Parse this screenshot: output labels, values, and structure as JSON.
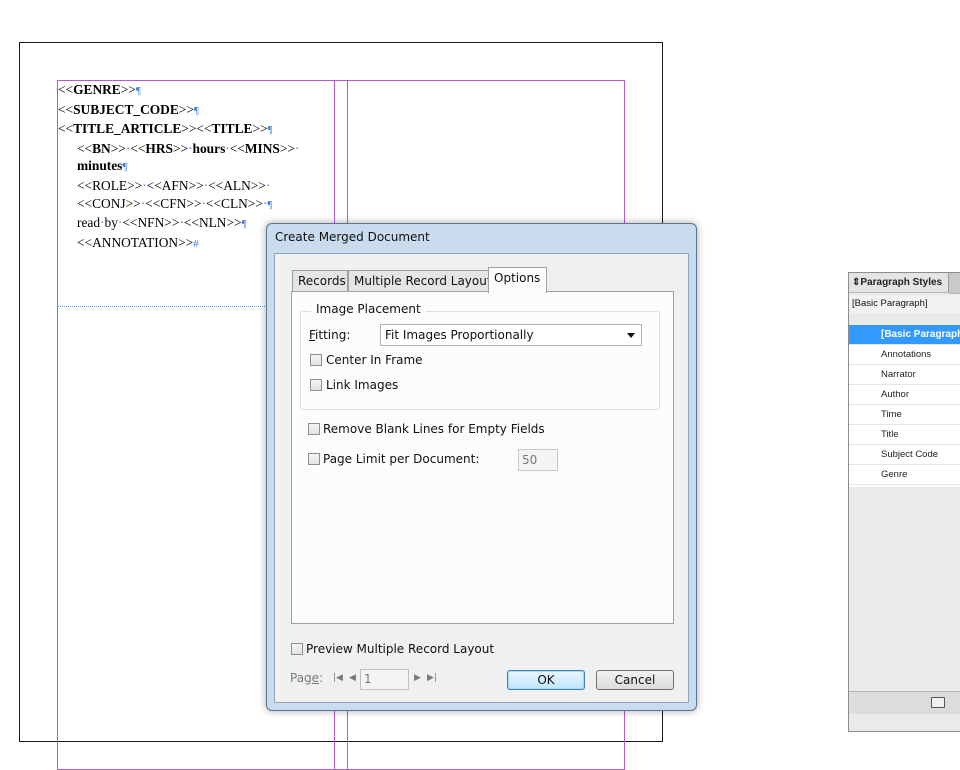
{
  "document": {
    "lines": [
      {
        "parts": [
          {
            "t": "<<",
            "b": false
          },
          {
            "t": "GENRE",
            "b": true
          },
          {
            "t": ">>",
            "b": false
          }
        ],
        "end": "¶",
        "indent": false
      },
      {
        "parts": [
          {
            "t": "<<",
            "b": false
          },
          {
            "t": "SUBJECT_CODE",
            "b": true
          },
          {
            "t": ">>",
            "b": false
          }
        ],
        "end": "¶",
        "indent": false
      },
      {
        "parts": [
          {
            "t": "<<",
            "b": false
          },
          {
            "t": "TITLE_ARTICLE",
            "b": true
          },
          {
            "t": ">><<",
            "b": false
          },
          {
            "t": "TITLE",
            "b": true
          },
          {
            "t": ">>",
            "b": false
          }
        ],
        "end": "¶",
        "indent": false
      },
      {
        "parts": [
          {
            "t": "<<",
            "b": false
          },
          {
            "t": "BN",
            "b": true
          },
          {
            "t": ">>",
            "b": false
          },
          {
            "t": "·",
            "dot": true
          },
          {
            "t": "<<",
            "b": false
          },
          {
            "t": "HRS",
            "b": true
          },
          {
            "t": ">>",
            "b": false
          },
          {
            "t": "·",
            "dot": true
          },
          {
            "t": "hours",
            "b": true
          },
          {
            "t": "·",
            "dot": true
          },
          {
            "t": "<<",
            "b": false
          },
          {
            "t": "MINS",
            "b": true
          },
          {
            "t": ">>",
            "b": false
          },
          {
            "t": "·",
            "dot": true
          }
        ],
        "end": "",
        "indent": true
      },
      {
        "parts": [
          {
            "t": "minutes",
            "b": true
          }
        ],
        "end": "¶",
        "indent": true
      },
      {
        "parts": [
          {
            "t": "<<ROLE>>",
            "b": false
          },
          {
            "t": "·",
            "dot": true
          },
          {
            "t": "<<AFN>>",
            "b": false
          },
          {
            "t": "·",
            "dot": true
          },
          {
            "t": "<<ALN>>",
            "b": false
          },
          {
            "t": "·",
            "dot": true
          }
        ],
        "end": "",
        "indent": true
      },
      {
        "parts": [
          {
            "t": "<<CONJ>>",
            "b": false
          },
          {
            "t": "·",
            "dot": true
          },
          {
            "t": "<<CFN>>",
            "b": false
          },
          {
            "t": "·",
            "dot": true
          },
          {
            "t": "<<CLN>>",
            "b": false
          },
          {
            "t": "·",
            "dot": true
          }
        ],
        "end": "¶",
        "indent": true
      },
      {
        "parts": [
          {
            "t": "read",
            "b": false
          },
          {
            "t": "·",
            "dot": true
          },
          {
            "t": "by",
            "b": false
          },
          {
            "t": "·",
            "dot": true
          },
          {
            "t": "<<NFN>>",
            "b": false
          },
          {
            "t": "·",
            "dot": true
          },
          {
            "t": "<<NLN>>",
            "b": false
          }
        ],
        "end": "¶",
        "indent": true
      },
      {
        "parts": [
          {
            "t": "<<ANNOTATION>>",
            "b": false
          }
        ],
        "end": "#",
        "indent": true
      }
    ]
  },
  "panel": {
    "title": "Paragraph Styles",
    "tab_icon": "chevron-updown-icon",
    "current_style": "[Basic Paragraph]",
    "items": [
      {
        "label": "[Basic Paragraph]",
        "selected": true
      },
      {
        "label": "Annotations",
        "selected": false
      },
      {
        "label": "Narrator",
        "selected": false
      },
      {
        "label": "Author",
        "selected": false
      },
      {
        "label": "Time",
        "selected": false
      },
      {
        "label": "Title",
        "selected": false
      },
      {
        "label": "Subject Code",
        "selected": false
      },
      {
        "label": "Genre",
        "selected": false
      }
    ]
  },
  "dialog": {
    "title": "Create Merged Document",
    "tabs": {
      "records": "Records",
      "multiple": "Multiple Record Layout",
      "options": "Options"
    },
    "image_placement": {
      "group_label": "Image Placement",
      "fitting_label_first": "F",
      "fitting_label_rest": "itting:",
      "fitting_value": "Fit Images Proportionally",
      "center_label": "Center In Frame",
      "center_checked": false,
      "link_label": "Link Images",
      "link_checked": false
    },
    "remove_blank_label": "Remove Blank Lines for Empty Fields",
    "remove_blank_checked": false,
    "page_limit_label": "Page Limit per Document:",
    "page_limit_checked": false,
    "page_limit_value": "50",
    "preview_label": "Preview Multiple Record Layout",
    "preview_checked": false,
    "page_label_first": "Pag",
    "page_label_u": "e",
    "page_label_rest": ":",
    "page_value": "1",
    "ok_label": "OK",
    "cancel_label": "Cancel"
  }
}
